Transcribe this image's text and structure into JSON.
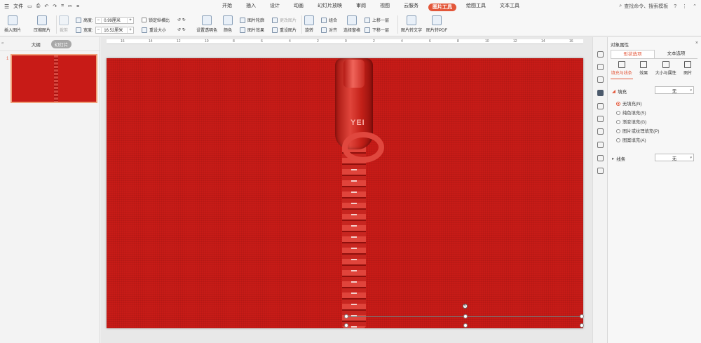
{
  "topbar": {
    "file_menu": "文件",
    "tabs": [
      "开始",
      "插入",
      "设计",
      "动画",
      "幻灯片放映",
      "审阅",
      "视图",
      "云服务",
      "图片工具",
      "绘图工具",
      "文本工具"
    ],
    "active_tab": "图片工具",
    "search_placeholder": "查找命令、搜索模板",
    "help": "?",
    "more": "⋮"
  },
  "ribbon": {
    "insert_picture": "插入图片",
    "compress_picture": "压缩图片",
    "crop": "裁剪",
    "height_label": "高度:",
    "height_value": "0.99厘米",
    "width_label": "宽度:",
    "width_value": "16.52厘米",
    "lock_ratio": "锁定纵横比",
    "reset_size": "重设大小",
    "set_transparent": "设置透明色",
    "color": "颜色",
    "picture_outline": "图片轮廓",
    "picture_effect": "图片效果",
    "change_picture": "更改图片",
    "reset_picture": "重设图片",
    "rotate": "旋转",
    "group": "组合",
    "align": "对齐",
    "selection_pane": "选择窗格",
    "bring_forward": "上移一层",
    "send_backward": "下移一层",
    "pic_to_text": "图片转文字",
    "pic_to_pdf": "图片转PDF"
  },
  "left_pane": {
    "tab_outline": "大纲",
    "tab_slides": "幻灯片",
    "slide_number": "1"
  },
  "ruler": [
    "16",
    "14",
    "12",
    "10",
    "8",
    "6",
    "4",
    "2",
    "0",
    "2",
    "4",
    "6",
    "8",
    "10",
    "12",
    "14",
    "16"
  ],
  "slide": {
    "zipper_logo": "YEI",
    "background_color": "#c81b17"
  },
  "right_pane": {
    "title": "对象属性",
    "tab_shape": "形状选项",
    "tab_text": "文本选项",
    "subtabs": [
      "填充与线条",
      "效果",
      "大小与属性",
      "图片"
    ],
    "fill_label": "填充",
    "fill_value": "无",
    "fill_options": [
      "无填充(N)",
      "纯色填充(S)",
      "渐变填充(G)",
      "图片或纹理填充(P)",
      "图案填充(A)"
    ],
    "line_label": "线条",
    "line_value": "无"
  }
}
